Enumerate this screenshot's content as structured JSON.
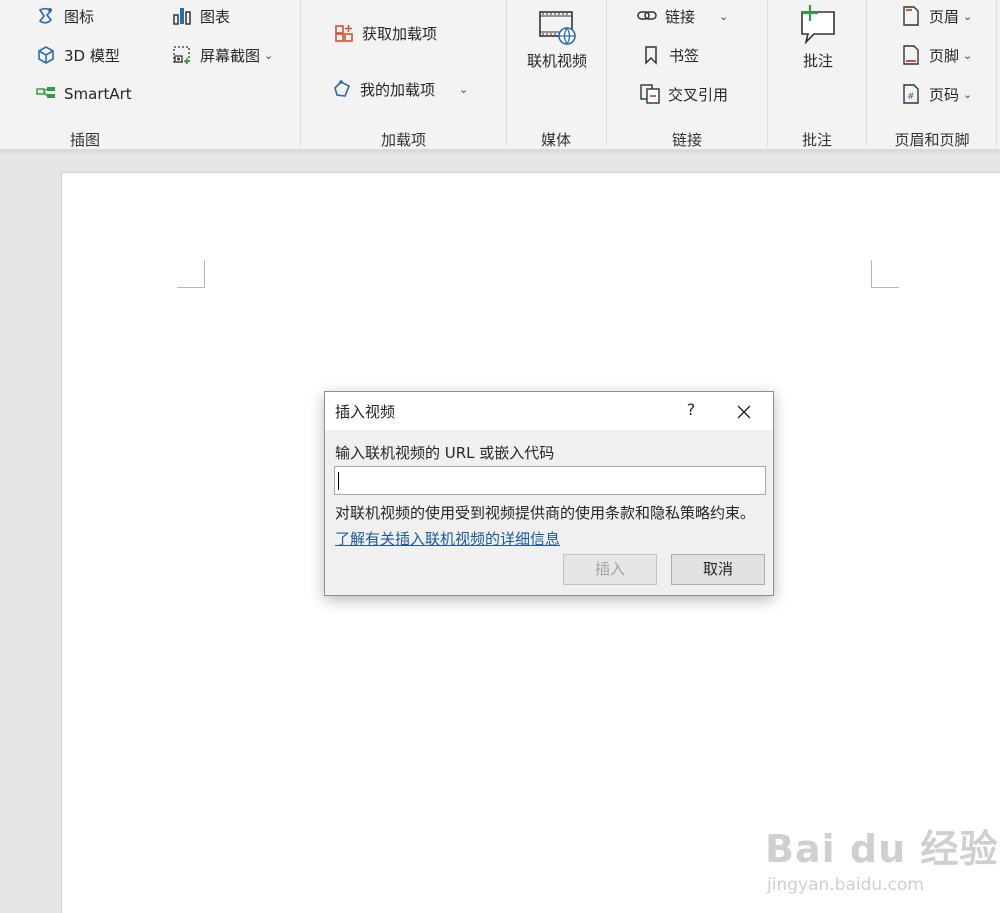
{
  "ribbon": {
    "illustrations": {
      "icons_label": "图标",
      "model3d_label": "3D 模型",
      "smartart_label": "SmartArt",
      "chart_label": "图表",
      "screenshot_label": "屏幕截图",
      "group_label": "插图"
    },
    "addins": {
      "get_label": "获取加载项",
      "my_label": "我的加载项",
      "group_label": "加载项"
    },
    "media": {
      "online_video_label": "联机视频",
      "group_label": "媒体"
    },
    "links": {
      "link_label": "链接",
      "bookmark_label": "书签",
      "crossref_label": "交叉引用",
      "group_label": "链接"
    },
    "comments": {
      "comment_label": "批注",
      "group_label": "批注"
    },
    "header_footer": {
      "header_label": "页眉",
      "footer_label": "页脚",
      "page_number_label": "页码",
      "group_label": "页眉和页脚"
    }
  },
  "dialog": {
    "title": "插入视频",
    "help": "?",
    "prompt": "输入联机视频的 URL 或嵌入代码",
    "input_value": "",
    "note": "对联机视频的使用受到视频提供商的使用条款和隐私策略约束。",
    "link": "了解有关插入联机视频的详细信息",
    "insert_label": "插入",
    "cancel_label": "取消"
  },
  "watermark": {
    "line1": "Bai du 经验",
    "line2": "jingyan.baidu.com"
  },
  "colors": {
    "accent_orange": "#d35230",
    "accent_green": "#2e9e44",
    "link_blue": "#1a5a9e",
    "icon_blue": "#2b6cb0"
  }
}
